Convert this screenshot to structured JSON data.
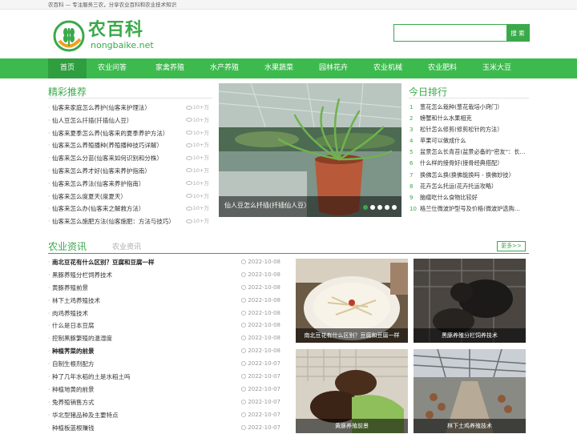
{
  "topbar": {
    "text": "农百科 — 专注服务三农，分享农业百科和农业技术知识"
  },
  "logo": {
    "cn": "农百科",
    "en": "nongbaike.net"
  },
  "search": {
    "placeholder": "",
    "button": "搜 索"
  },
  "nav": [
    "首页",
    "农业问答",
    "家禽养殖",
    "水产养殖",
    "水果蔬菜",
    "园林花卉",
    "农业机械",
    "农业肥料",
    "玉米大豆"
  ],
  "sections": {
    "recommend": "精彩推荐",
    "ranking": "今日排行",
    "news_tab1": "农业资讯",
    "news_tab2": "农业资讯",
    "more": "更多>>"
  },
  "recommend": [
    {
      "title": "仙客来家庭怎么养护(仙客来护理法）",
      "views": "10+万"
    },
    {
      "title": "仙人豆怎么扦插(扦插仙人豆）",
      "views": "10+万"
    },
    {
      "title": "仙客来夏季怎么养(仙客来的夏季养护方法）",
      "views": "10+万"
    },
    {
      "title": "仙客来怎么养殖播种(养殖播种技巧详解）",
      "views": "10+万"
    },
    {
      "title": "仙客来怎么分苗(仙客来如何识别和分株）",
      "views": "10+万"
    },
    {
      "title": "仙客来怎么养才好(仙客来养护指南）",
      "views": "10+万"
    },
    {
      "title": "仙客来怎么养法(仙客来养护指南）",
      "views": "10+万"
    },
    {
      "title": "仙客来怎么度夏天(度夏天）",
      "views": "10+万"
    },
    {
      "title": "仙客来怎么办(仙客来之解救方法）",
      "views": "10+万"
    },
    {
      "title": "仙客来怎么施肥方法(仙客施肥：方法与技巧）",
      "views": "10+万"
    }
  ],
  "slider": {
    "caption": "仙人豆怎么扦插(扦插仙人豆）"
  },
  "ranking": [
    "葱花怎么栽种(葱花栽培小窍门）",
    "螃蟹和什么水果相克",
    "松针怎么修剪(修剪松针的方法）",
    "苹果可以做成什么",
    "盆景怎么长青苔(盆景必备的\"密友\"：长…",
    "什么样的接骨好(接骨经典搭配）",
    "换佛怎么换(换佛能换吗 - 换佛妙技）",
    "花卉怎么托运(花卉托运攻略）",
    "脑瘤吃什么食物比较好",
    "格兰仕微波炉型号及价格(微波炉选购…"
  ],
  "news": [
    {
      "title": "南北豆花有什么区别？豆腐和豆腐一样",
      "date": "2022-10-08",
      "bold": true
    },
    {
      "title": "黑豚养殖分栏饲养技术",
      "date": "2022-10-08",
      "bold": false
    },
    {
      "title": "黄豚养殖前景",
      "date": "2022-10-08",
      "bold": false
    },
    {
      "title": "林下土鸡养殖技术",
      "date": "2022-10-08",
      "bold": false
    },
    {
      "title": "肉鸡养殖技术",
      "date": "2022-10-08",
      "bold": false
    },
    {
      "title": "什么是日本豆腐",
      "date": "2022-10-08",
      "bold": false
    },
    {
      "title": "控制黑豚繁殖的温湿度",
      "date": "2022-10-08",
      "bold": false
    },
    {
      "title": "种植荠菜的前景",
      "date": "2022-10-08",
      "bold": true
    },
    {
      "title": "自制生根剂配方",
      "date": "2022-10-07",
      "bold": false
    },
    {
      "title": "种了几年水稻的土是水稻土吗",
      "date": "2022-10-07",
      "bold": false
    },
    {
      "title": "种植地黄的前景",
      "date": "2022-10-07",
      "bold": false
    },
    {
      "title": "兔养殖销售方式",
      "date": "2022-10-07",
      "bold": false
    },
    {
      "title": "华北型猪品种及主要特点",
      "date": "2022-10-07",
      "bold": false
    },
    {
      "title": "种植板蓝根赚钱",
      "date": "2022-10-07",
      "bold": false
    }
  ],
  "photos": [
    {
      "caption": "南北豆花有什么区别？豆腐和豆腐一样"
    },
    {
      "caption": "黑豚养殖分栏饲养技术"
    },
    {
      "caption": "黄豚养殖前景"
    },
    {
      "caption": "林下土鸡养殖技术"
    }
  ],
  "colors": {
    "brand": "#3aa94a",
    "nav": "#3dba4e",
    "nav_active": "#2f9e3f"
  }
}
